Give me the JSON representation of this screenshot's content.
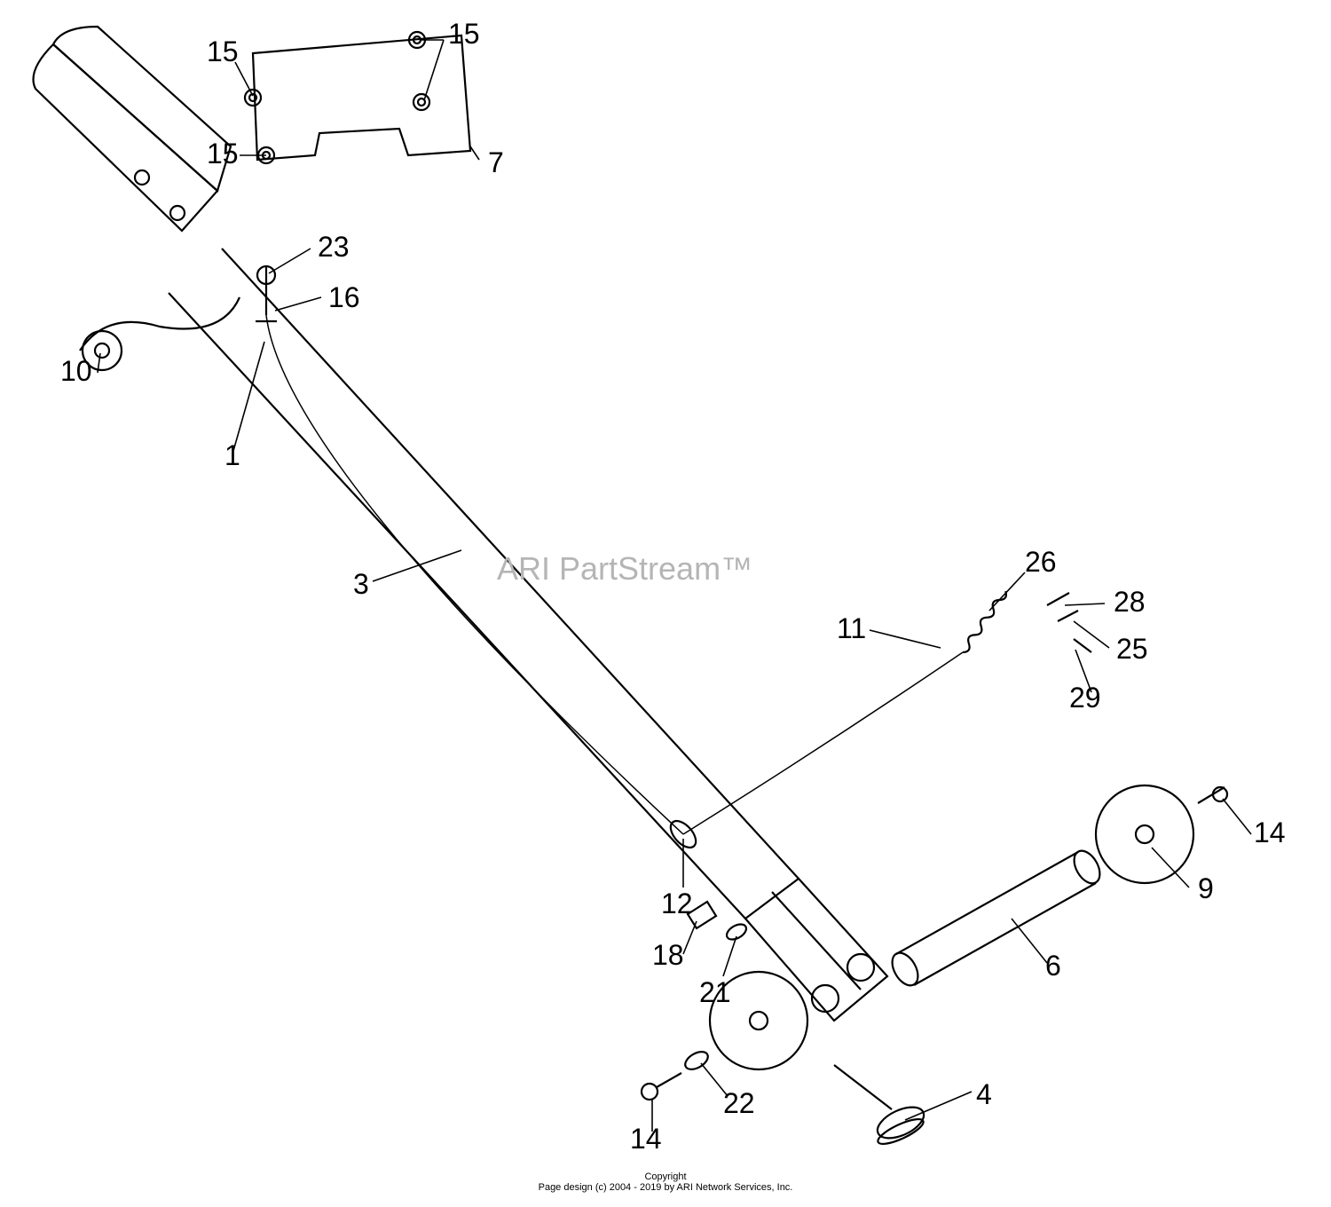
{
  "watermark": "ARI PartStream™",
  "copyright_line1": "Copyright",
  "copyright_line2": "Page design (c) 2004 - 2019 by ARI Network Services, Inc.",
  "callouts": {
    "c15a": "15",
    "c15b": "15",
    "c15c": "15",
    "c7": "7",
    "c23": "23",
    "c16": "16",
    "c10": "10",
    "c1": "1",
    "c3": "3",
    "c11": "11",
    "c26": "26",
    "c28": "28",
    "c25": "25",
    "c29": "29",
    "c12": "12",
    "c18": "18",
    "c21": "21",
    "c14a": "14",
    "c9": "9",
    "c6": "6",
    "c4": "4",
    "c22": "22",
    "c14b": "14"
  }
}
